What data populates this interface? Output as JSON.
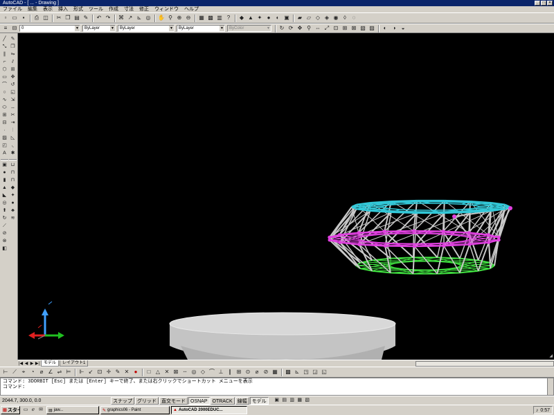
{
  "window": {
    "title": "AutoCAD - [ ... - Drawing ]",
    "controls": [
      "_",
      "□",
      "×"
    ]
  },
  "menubar": {
    "items": [
      "ファイル",
      "編集",
      "表示",
      "挿入",
      "形式",
      "ツール",
      "作成",
      "寸法",
      "修正",
      "ウィンドウ",
      "ヘルプ"
    ]
  },
  "toolbars": {
    "layer_combo": "0",
    "color_combo": "ByLayer",
    "linetype_combo": "ByLayer",
    "lineweight_combo": "ByLayer",
    "plotstyle_combo": "ByColor"
  },
  "viewport": {
    "background": "#000000",
    "top_ring_color": "#33c8d8",
    "middle_ring_color": "#e040e0",
    "bottom_ring_color": "#40e040",
    "strut_color": "#c8c8c8",
    "base_color": "#d8d8d8",
    "ucs_x_color": "#e02020",
    "ucs_y_color": "#20c020",
    "ucs_z_color": "#40a0ff"
  },
  "tabs": {
    "nav": [
      "|◀",
      "◀",
      "▶",
      "▶|"
    ],
    "model": "モデル",
    "layout": "レイアウト1"
  },
  "command": {
    "line1": "コマンド: 3DORBIT  [Esc] または [Enter] キーで終了、または右クリックでショートカット メニューを表示",
    "line2": "コマンド:"
  },
  "status": {
    "coords": "2044.7,  300.0,  0.0",
    "toggles": [
      {
        "label": "スナップ",
        "on": false
      },
      {
        "label": "グリッド",
        "on": false
      },
      {
        "label": "直交モード",
        "on": false
      },
      {
        "label": "OSNAP",
        "on": true
      },
      {
        "label": "OTRACK",
        "on": false
      },
      {
        "label": "線幅",
        "on": false
      },
      {
        "label": "モデル",
        "on": true
      }
    ]
  },
  "taskbar": {
    "start": "スタート",
    "tasks": [
      {
        "label": "jaw...",
        "active": false
      },
      {
        "label": "graphics06 - Paint",
        "active": false
      },
      {
        "label": "AutoCAD 2000EDUC...",
        "active": true
      }
    ],
    "clock": "0:57"
  }
}
